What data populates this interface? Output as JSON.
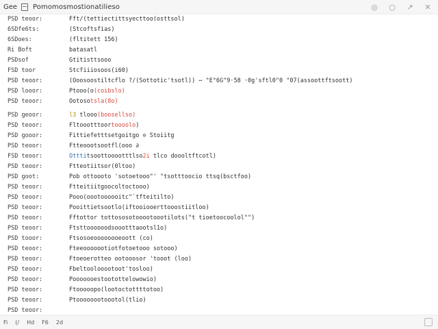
{
  "window": {
    "menu_label": "Gee",
    "title": "Pomomosmostionatilieso",
    "controls": {
      "a": "◎",
      "b": "○",
      "c": "↗",
      "close": "✕"
    }
  },
  "rows": [
    {
      "label": "PSD teoor:",
      "cmd": [
        {
          "t": "Fft/(tettiectittsyecttoo(osttsol)"
        }
      ]
    },
    {
      "label": "6SDfe6ts:",
      "cmd": [
        {
          "t": "(Stcoftsfias)"
        }
      ]
    },
    {
      "label": "6SDoes:",
      "cmd": [
        {
          "t": "(fltitett 156)"
        }
      ]
    },
    {
      "label": "Ri Boft",
      "cmd": [
        {
          "t": "batasatl"
        }
      ]
    },
    {
      "label": "PSDsof",
      "cmd": [
        {
          "t": "Gtitisttsooo"
        }
      ]
    },
    {
      "label": "FSD toor",
      "cmd": [
        {
          "t": "Stcfiiiosoos(i60)"
        }
      ]
    },
    {
      "label": "PSD teoor:",
      "cmd": [
        {
          "t": "(Ooosoostiltcflo ?/(Sottotic'tsotl)) ⋯ \"E°6G\"9·58 ·0g'sftl0\"0 \"07(assoottftsoott)"
        }
      ]
    },
    {
      "label": "PSD looor:",
      "cmd": [
        {
          "t": "Ptooo(o"
        },
        {
          "t": "(coibslo)",
          "c": "hi"
        }
      ]
    },
    {
      "label": "PSD teoor:",
      "cmd": [
        {
          "t": "Ootoso"
        },
        {
          "t": "tsla(8o)",
          "c": "hi"
        }
      ]
    },
    {
      "label": "PSD geoor:",
      "cmd": [
        {
          "t": "l3 ",
          "c": "yl"
        },
        {
          "t": "tlooo"
        },
        {
          "t": "(boosellso)",
          "c": "hi"
        }
      ]
    },
    {
      "label": "PSD teoor:",
      "cmd": [
        {
          "t": "Fltoootttoor"
        },
        {
          "t": "toooolo",
          "c": "hi"
        },
        {
          "t": ")"
        }
      ]
    },
    {
      "label": "PSD gooor:",
      "cmd": [
        {
          "t": "Fittiefetttsetgoitgo ⊙ Stoiitg"
        }
      ]
    },
    {
      "label": "PSD teoor:",
      "cmd": [
        {
          "t": "Ftteoootsootfl(ooo ∂"
        }
      ]
    },
    {
      "label": "FSD teoor:",
      "cmd": [
        {
          "t": "Ottti",
          "c": "bl"
        },
        {
          "t": "tsoottooootttlso"
        },
        {
          "t": "2i",
          "c": "hi"
        },
        {
          "t": " tlco doooltftcotl)"
        }
      ]
    },
    {
      "label": "PSD teoor:",
      "cmd": [
        {
          "t": "Ftteotiitsor(0ltoo)"
        }
      ]
    },
    {
      "label": "PSD goot:",
      "cmd": [
        {
          "t": "Pob ottoooto 'sotoetooo\"'  \"tsotttoocio ttsq(bsctfoo)"
        }
      ]
    },
    {
      "label": "PSD teoor:",
      "cmd": [
        {
          "t": "Ftteitiitgoocoltoctooo)"
        }
      ]
    },
    {
      "label": "PSD teoor:",
      "cmd": [
        {
          "t": "Pooo(oootoooooitc\"`tfteitilto)"
        }
      ]
    },
    {
      "label": "PSD teoor:",
      "cmd": [
        {
          "t": "Pooittietsootlo(iftooiooerttooostiitloo)"
        }
      ]
    },
    {
      "label": "PSD teoor:",
      "cmd": [
        {
          "t": "Fftottor tottososotooootoootilots(\"t  tioetoocoolol\"\")"
        }
      ]
    },
    {
      "label": "PSD teoor:",
      "cmd": [
        {
          "t": "Ftsttoooooodsoootttaootsl1o)"
        }
      ]
    },
    {
      "label": "PSD tooor:",
      "cmd": [
        {
          "t": "Ftsosoeoooooooeoott (co)"
        }
      ]
    },
    {
      "label": "PSD teoor:",
      "cmd": [
        {
          "t": "Fteeooooootiotfotoetooo sotooo)"
        }
      ]
    },
    {
      "label": "PSD teoor:",
      "cmd": [
        {
          "t": "Ftoeoerotteo  ootooosor 'tooot (loo)"
        }
      ]
    },
    {
      "label": "PSD teoor:",
      "cmd": [
        {
          "t": "Fbeltoolooootoot'tosloo)"
        }
      ]
    },
    {
      "label": "PSD teoor:",
      "cmd": [
        {
          "t": "Pooooooestootottelowowio)"
        }
      ]
    },
    {
      "label": "PSD teoor:",
      "cmd": [
        {
          "t": "Ftooooopo(lootoctottttotoo)"
        }
      ]
    },
    {
      "label": "PSD teoor:",
      "cmd": [
        {
          "t": "Ptoooooootoootol(tlio)"
        }
      ]
    },
    {
      "label": "PSD teoor:",
      "cmd": []
    }
  ],
  "statusbar": {
    "items": [
      "Fi",
      "(/",
      "Hd",
      "F6",
      "2d"
    ]
  }
}
